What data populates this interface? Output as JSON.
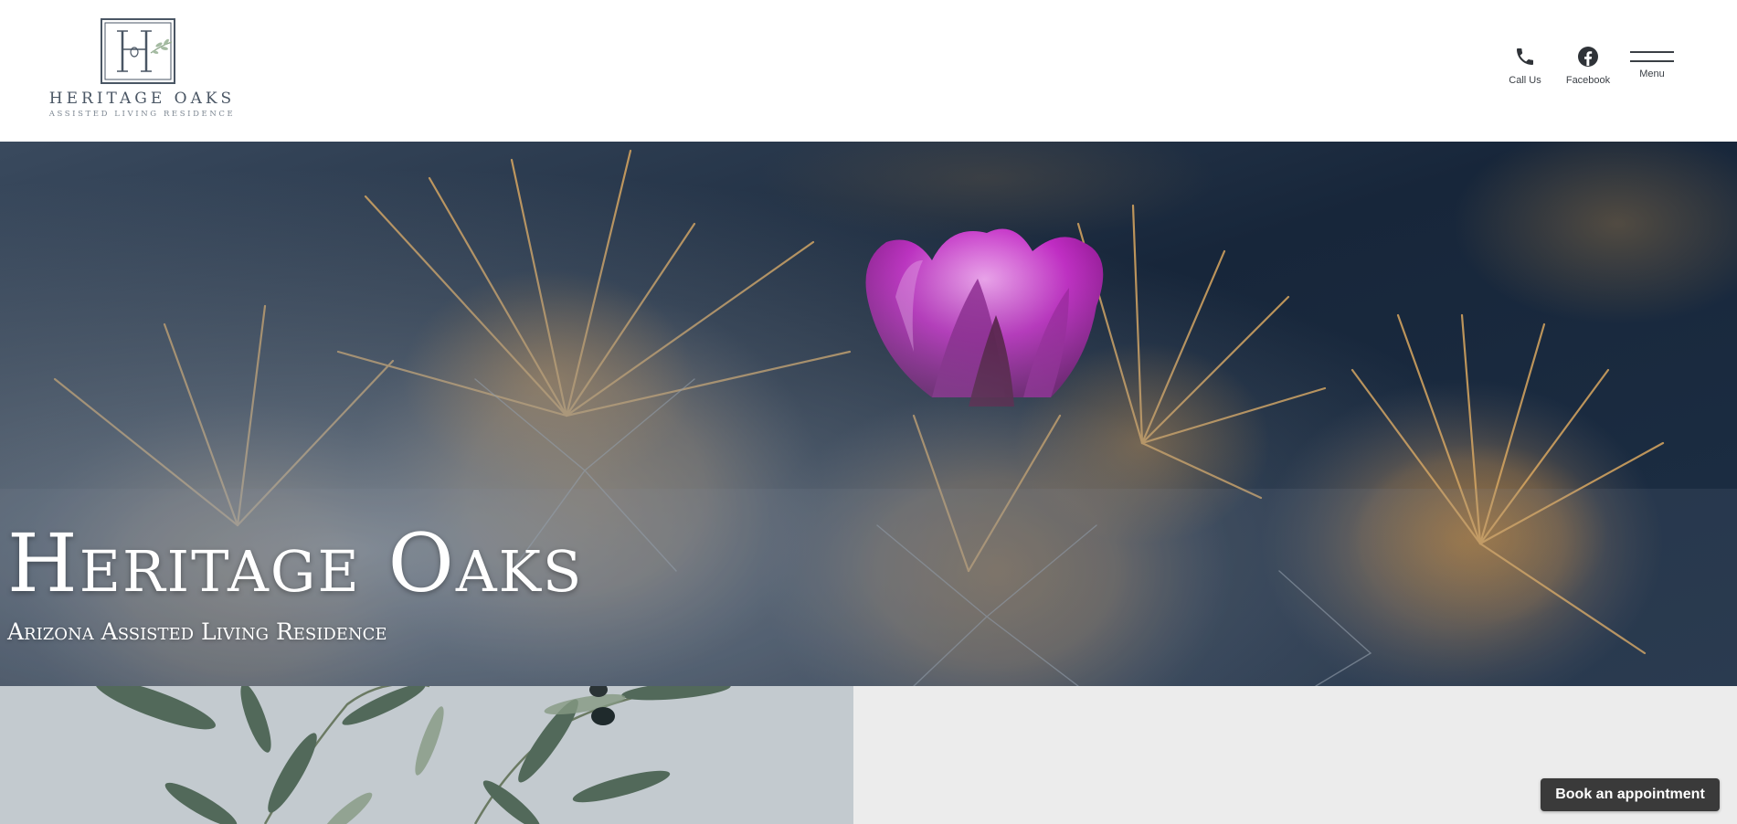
{
  "header": {
    "logo": {
      "monogram": "HO",
      "name": "HERITAGE OAKS",
      "tagline": "ASSISTED LIVING RESIDENCE"
    },
    "nav": {
      "call_label": "Call Us",
      "facebook_label": "Facebook",
      "menu_label": "Menu"
    }
  },
  "hero": {
    "title": "Heritage Oaks",
    "subtitle": "Arizona Assisted Living Residence"
  },
  "cta": {
    "book_label": "Book an appointment"
  },
  "colors": {
    "header_bg": "#ffffff",
    "hero_bg": "#1d2b3d",
    "logo_text": "#4a5664",
    "cta_bg": "#3a3a3a",
    "lower_right_bg": "#ececec"
  }
}
